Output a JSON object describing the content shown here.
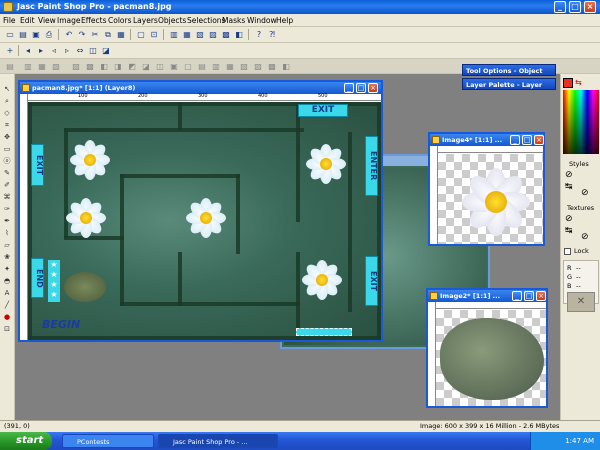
{
  "app": {
    "title": "Jasc Paint Shop Pro - pacman8.jpg"
  },
  "menu": [
    "File",
    "Edit",
    "View",
    "Image",
    "Effects",
    "Colors",
    "Layers",
    "Objects",
    "Selections",
    "Masks",
    "Window",
    "Help"
  ],
  "palettes": {
    "tool_options": "Tool Options - Object",
    "layer_palette": "Layer Palette - Layer"
  },
  "right_panel": {
    "styles": "Styles",
    "textures": "Textures",
    "lock": "Lock",
    "r": "R",
    "g": "G",
    "b": "B",
    "r_val": "--",
    "g_val": "--",
    "b_val": "--"
  },
  "main_doc": {
    "title": "pacman8.jpg* [1:1] (Layer8)",
    "ruler_marks": [
      "100",
      "200",
      "300",
      "400",
      "500"
    ],
    "signs": {
      "exit_top": "EXIT",
      "exit_left": "EXIT",
      "enter_right": "ENTER",
      "exit_right": "EXIT",
      "end": "END",
      "begin": "BEGIN"
    }
  },
  "image4": {
    "title": "Image4* [1:1] ..."
  },
  "image2": {
    "title": "Image2* [1:1] ..."
  },
  "status": {
    "coords": "(391, 0)",
    "info": "Image: 600 x 399 x 16 Million - 2.6 MBytes"
  },
  "taskbar": {
    "start": "start",
    "tasks": [
      "PContests",
      "Jasc Paint Shop Pro - ..."
    ],
    "clock": "1:47 AM"
  },
  "colors": {
    "titlebar": "#0a5fd8",
    "taskbar": "#2458d8",
    "start": "#2a9a2a"
  }
}
